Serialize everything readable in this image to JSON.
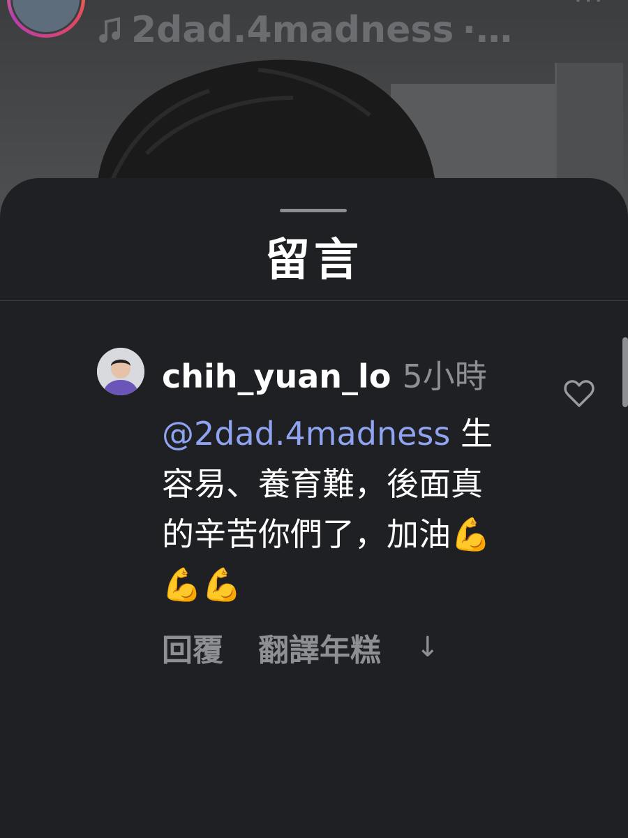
{
  "header": {
    "username": "2dad.4madness",
    "music_icon": "music-note-icon",
    "more_icon": "more-icon"
  },
  "comments_sheet": {
    "title": "留言"
  },
  "comment": {
    "username": "chih_yuan_lo",
    "time": "5小時",
    "mention": "@2dad.4madness",
    "text": " 生容易、養育難，後面真的辛苦你們了，加油💪💪💪",
    "reply_label": "回覆",
    "translate_label": "翻譯年糕",
    "expand_icon": "↓",
    "like_icon": "heart-icon"
  },
  "colors": {
    "sheet_bg": "#1f2023",
    "mention": "#8fa3f0",
    "muted_text": "#8e8f93"
  }
}
